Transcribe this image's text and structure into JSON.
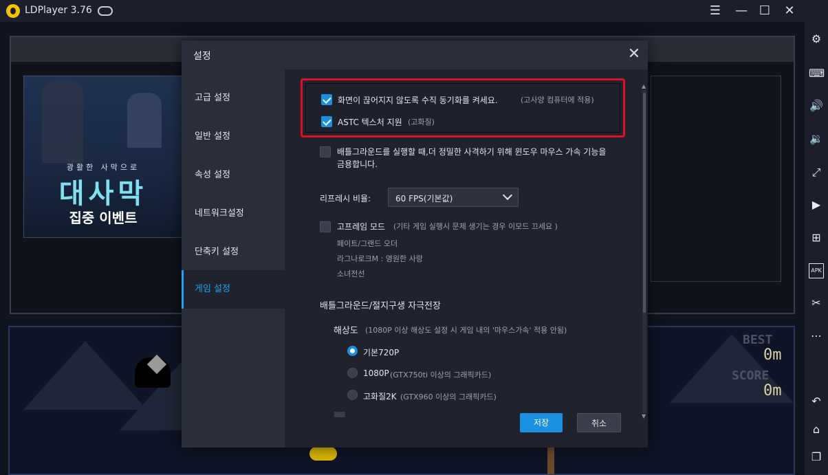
{
  "titlebar": {
    "app_title": "LDPlayer 3.76",
    "buttons": [
      "menu-icon",
      "minimize-icon",
      "maximize-icon",
      "close-icon"
    ]
  },
  "sidebar": {
    "icons": [
      "settings-icon",
      "keyboard-icon",
      "volume-up-icon",
      "volume-down-icon",
      "fullscreen-icon",
      "record-icon",
      "add-app-icon",
      "apk-icon",
      "scissors-icon",
      "more-icon",
      "back-icon",
      "home-icon",
      "recent-apps-icon"
    ],
    "apk_label": "APK"
  },
  "background": {
    "banner_small": "광활한 사막으로",
    "banner_big": "대사막",
    "banner_sub": "집중 이벤트",
    "score": {
      "best_label": "BEST",
      "best_value": "0m",
      "score_label": "SCORE",
      "score_value": "0m"
    }
  },
  "dialog": {
    "title": "설정",
    "nav": [
      {
        "label": "고급 설정"
      },
      {
        "label": "일반 설정"
      },
      {
        "label": "속성 설정"
      },
      {
        "label": "네트워크설정"
      },
      {
        "label": "단축키 설정"
      },
      {
        "label": "게임 설정"
      }
    ],
    "active_nav": "게임 설정",
    "vsync": {
      "label": "화면이 끊어지지 않도록 수직 동기화를 켜세요.",
      "note": "(고사양 컴퓨터에 적용)",
      "checked": true
    },
    "astc": {
      "label": "ASTC 텍스처 지원",
      "note": "(고화질)",
      "checked": true
    },
    "mouse_accel": {
      "line1": "배틀그라운드를 실행할 때,더 정밀한 사격하기 위해 윈도우 마우스 가속 기능을",
      "line2": "금용합니다.",
      "checked": false
    },
    "refresh": {
      "label": "리프레시 비율:",
      "value": "60 FPS(기본값)"
    },
    "high_fps": {
      "label": "고프레임 모드",
      "note": "(기타 게임 실행시 문제 생기는 경우 이모드 끄세요 )",
      "checked": false,
      "games": [
        "페이트/그랜드 오더",
        "라그나로크M : 영원한 사랑",
        "소녀전선"
      ]
    },
    "pubg_section": {
      "heading": "배틀그라운드/절지구생 자극전장",
      "resolution_label": "해상도",
      "resolution_note": "(1080P 이상 해상도 설정 시 게임 내의 '마우스가속' 적용 안됨)",
      "options": [
        {
          "label": "기본720P",
          "note": "",
          "selected": true
        },
        {
          "label": "1080P",
          "note": "(GTX750ti 이상의 그래픽카드)",
          "selected": false
        },
        {
          "label": "고화질2K",
          "note": "(GTX960 이상의 그래픽카드)",
          "selected": false
        }
      ]
    },
    "buttons": {
      "save": "저장",
      "cancel": "취소"
    }
  },
  "colors": {
    "accent": "#1a90e0",
    "highlight_border": "#e0102a",
    "dialog_bg": "#20232e"
  }
}
